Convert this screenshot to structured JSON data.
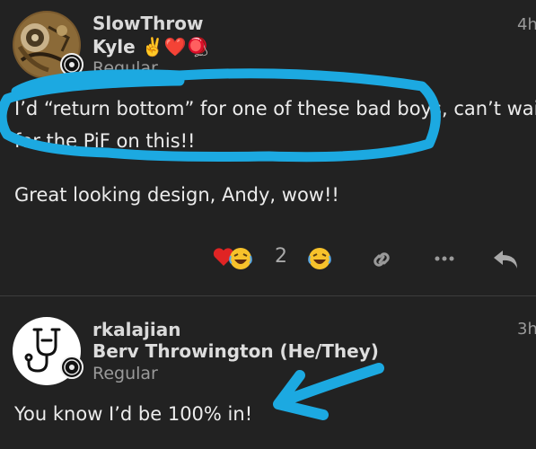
{
  "posts": [
    {
      "username": "SlowThrow",
      "full_name": "Kyle ✌️❤️🪀",
      "user_title": "Regular",
      "time": "4h",
      "lines": [
        "I’d “return bottom” for one of these bad boys, can’t wait",
        "for the PiF on this!!",
        "Great looking design, Andy, wow!!"
      ],
      "reactions": {
        "count": "2"
      }
    },
    {
      "username": "rkalajian",
      "full_name": "Berv Throwington (He/They)",
      "user_title": "Regular",
      "time": "3h",
      "lines": [
        "You know I’d be 100% in!"
      ]
    }
  ],
  "colors": {
    "background": "#222222",
    "annotation": "#1ca9e1",
    "heart": "#e02424",
    "emoji": "#f7c22b"
  },
  "icons": [
    "heart-icon",
    "laughing-emoji-icon",
    "link-icon",
    "more-icon",
    "reply-icon",
    "flair-badge-icon"
  ]
}
